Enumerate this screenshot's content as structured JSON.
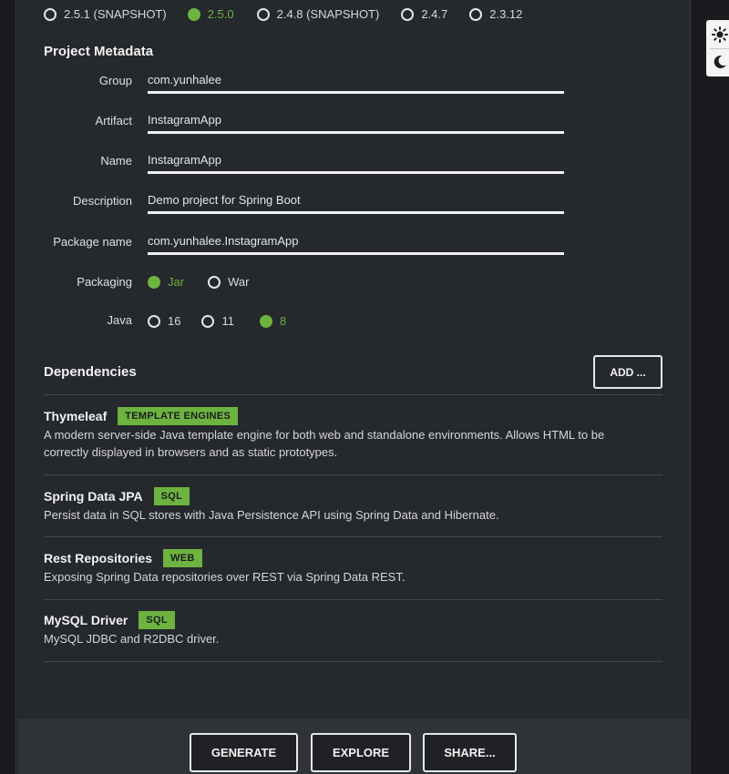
{
  "boot_versions": [
    {
      "label": "2.5.1 (SNAPSHOT)",
      "checked": false
    },
    {
      "label": "2.5.0",
      "checked": true
    },
    {
      "label": "2.4.8 (SNAPSHOT)",
      "checked": false
    },
    {
      "label": "2.4.7",
      "checked": false
    },
    {
      "label": "2.3.12",
      "checked": false
    }
  ],
  "metadata": {
    "title": "Project Metadata",
    "fields": [
      {
        "label": "Group",
        "value": "com.yunhalee"
      },
      {
        "label": "Artifact",
        "value": "InstagramApp"
      },
      {
        "label": "Name",
        "value": "InstagramApp"
      },
      {
        "label": "Description",
        "value": "Demo project for Spring Boot"
      },
      {
        "label": "Package name",
        "value": "com.yunhalee.InstagramApp"
      }
    ],
    "packaging": {
      "label": "Packaging",
      "options": [
        {
          "label": "Jar",
          "checked": true
        },
        {
          "label": "War",
          "checked": false
        }
      ]
    },
    "java": {
      "label": "Java",
      "options": [
        {
          "label": "16",
          "checked": false
        },
        {
          "label": "11",
          "checked": false
        },
        {
          "label": "8",
          "checked": true
        }
      ]
    }
  },
  "dependencies": {
    "title": "Dependencies",
    "add_label": "ADD ...",
    "items": [
      {
        "name": "Thymeleaf",
        "badge": "TEMPLATE ENGINES",
        "description": "A modern server-side Java template engine for both web and standalone environments. Allows HTML to be correctly displayed in browsers and as static prototypes."
      },
      {
        "name": "Spring Data JPA",
        "badge": "SQL",
        "description": "Persist data in SQL stores with Java Persistence API using Spring Data and Hibernate."
      },
      {
        "name": "Rest Repositories",
        "badge": "WEB",
        "description": "Exposing Spring Data repositories over REST via Spring Data REST."
      },
      {
        "name": "MySQL Driver",
        "badge": "SQL",
        "description": "MySQL JDBC and R2DBC driver."
      }
    ]
  },
  "footer": {
    "generate_label": "GENERATE",
    "explore_label": "EXPLORE",
    "share_label": "SHARE..."
  },
  "theme": {
    "light_icon": "sun-icon",
    "dark_icon": "moon-icon"
  },
  "colors": {
    "accent": "#6db33f",
    "background": "#25282c"
  }
}
